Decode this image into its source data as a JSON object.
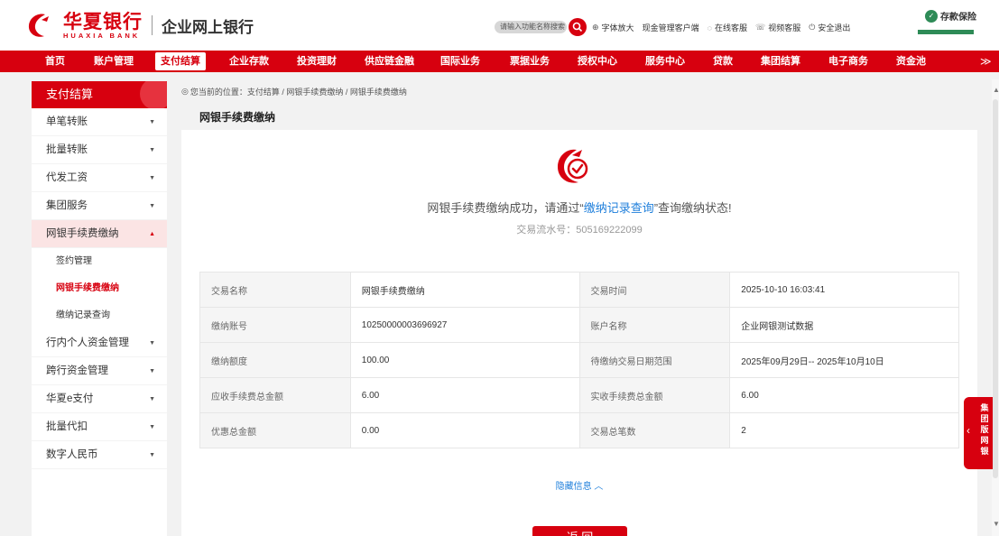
{
  "header": {
    "logo_cn": "华夏银行",
    "logo_en": "HUAXIA BANK",
    "subtitle": "企业网上银行",
    "search_placeholder": "请输入功能名称搜索",
    "links": [
      {
        "icon": "zoom-icon",
        "label": "字体放大"
      },
      {
        "icon": "",
        "label": "现金管理客户端"
      },
      {
        "icon": "chat-icon",
        "label": "在线客服"
      },
      {
        "icon": "video-icon",
        "label": "视频客服"
      },
      {
        "icon": "power-icon",
        "label": "安全退出"
      }
    ],
    "deposit_label": "存款保险"
  },
  "nav": {
    "items": [
      "首页",
      "账户管理",
      "支付结算",
      "企业存款",
      "投资理财",
      "供应链金融",
      "国际业务",
      "票据业务",
      "授权中心",
      "服务中心",
      "贷款",
      "集团结算",
      "电子商务",
      "资金池"
    ],
    "active_index": 2,
    "more_icon": "double-chevron-down-icon"
  },
  "sidebar": {
    "title": "支付结算",
    "items": [
      {
        "label": "单笔转账",
        "arrow": "▼"
      },
      {
        "label": "批量转账",
        "arrow": "▼"
      },
      {
        "label": "代发工资",
        "arrow": "▼"
      },
      {
        "label": "集团服务",
        "arrow": "▼"
      },
      {
        "label": "网银手续费缴纳",
        "arrow": "▲"
      },
      {
        "label": "行内个人资金管理",
        "arrow": "▼"
      },
      {
        "label": "跨行资金管理",
        "arrow": "▼"
      },
      {
        "label": "华夏e支付",
        "arrow": "▼"
      },
      {
        "label": "批量代扣",
        "arrow": "▼"
      },
      {
        "label": "数字人民币",
        "arrow": "▼"
      }
    ],
    "subitems": [
      "签约管理",
      "网银手续费缴纳",
      "缴纳记录查询"
    ],
    "current_sub": 1
  },
  "breadcrumb": {
    "prefix": "您当前的位置：",
    "path": "支付结算 / 网银手续费缴纳 / 网银手续费缴纳"
  },
  "page_title": "网银手续费缴纳",
  "result": {
    "msg_before": "网银手续费缴纳成功，请通过“",
    "msg_link": "缴纳记录查询",
    "msg_after": "”查询缴纳状态!",
    "serial_label": "交易流水号：",
    "serial_no": "505169222099"
  },
  "details": [
    [
      {
        "label": "交易名称",
        "value": "网银手续费缴纳"
      },
      {
        "label": "交易时间",
        "value": "2025-10-10 16:03:41"
      }
    ],
    [
      {
        "label": "缴纳账号",
        "value": "10250000003696927"
      },
      {
        "label": "账户名称",
        "value": "企业网银测试数据"
      }
    ],
    [
      {
        "label": "缴纳额度",
        "value": "100.00"
      },
      {
        "label": "待缴纳交易日期范围",
        "value": "2025年09月29日-- 2025年10月10日"
      }
    ],
    [
      {
        "label": "应收手续费总金额",
        "value": "6.00"
      },
      {
        "label": "实收手续费总金额",
        "value": "6.00"
      }
    ],
    [
      {
        "label": "优惠总金额",
        "value": "0.00"
      },
      {
        "label": "交易总笔数",
        "value": "2"
      }
    ]
  ],
  "toggle_label": "隐藏信息 ︿",
  "back_label": "返 回",
  "float_tab": {
    "label": "集团版网银",
    "icon": "chevron-left-icon"
  },
  "colors": {
    "brand_red": "#d7000f",
    "link_blue": "#1f7fdb"
  }
}
